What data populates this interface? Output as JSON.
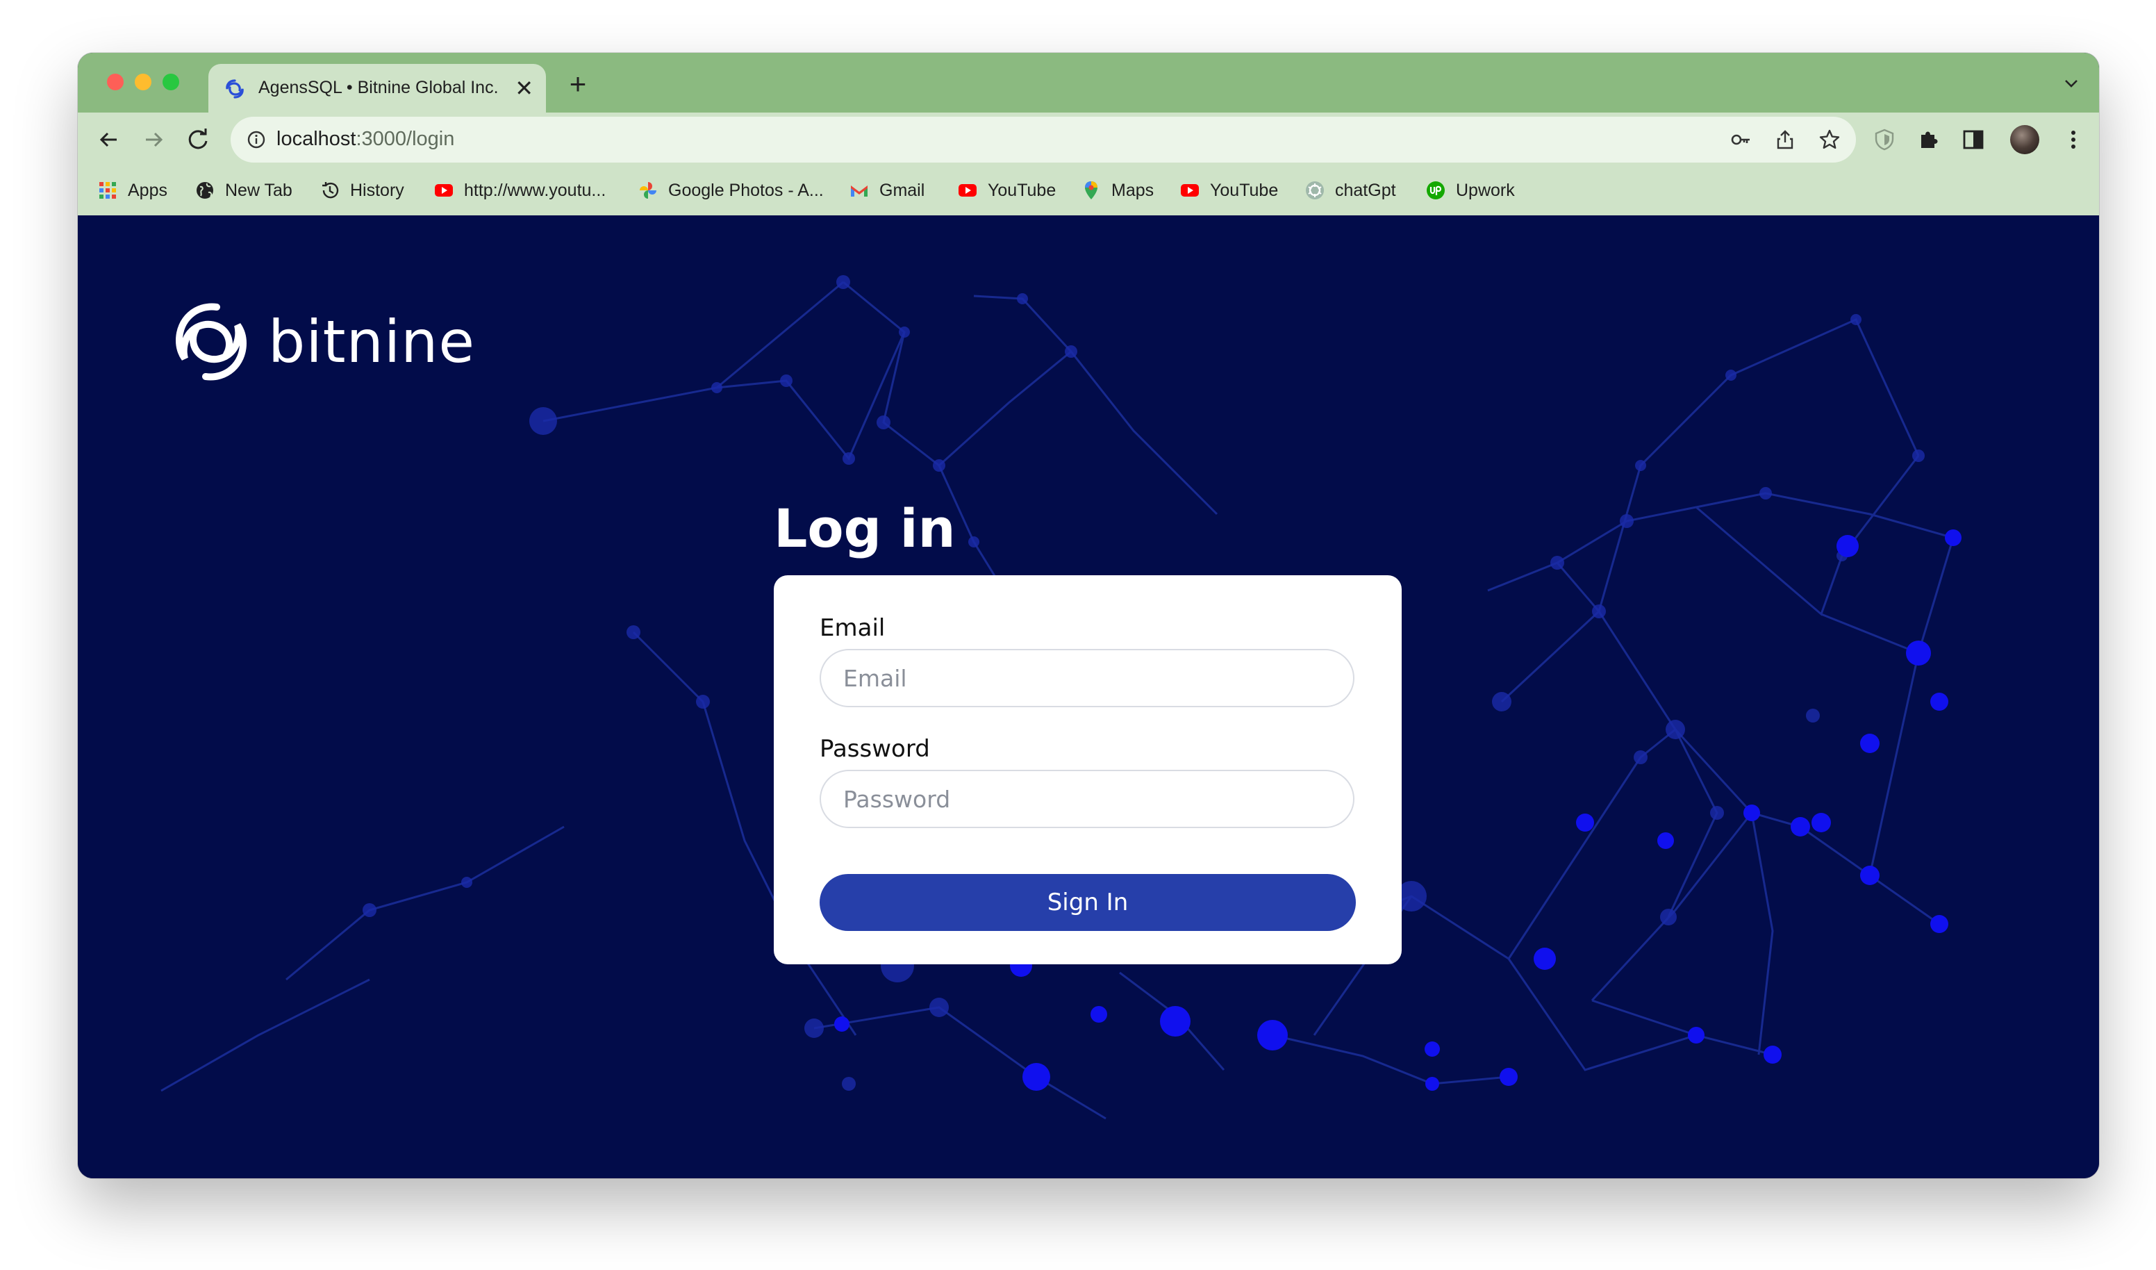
{
  "browser": {
    "tab": {
      "title": "AgensSQL • Bitnine Global Inc.",
      "close": "✕"
    },
    "new_tab": "+",
    "url": {
      "host": "localhost",
      "path": ":3000/login"
    },
    "bookmarks": [
      {
        "label": "Apps",
        "icon": "apps-grid-icon"
      },
      {
        "label": "New Tab",
        "icon": "globe-icon"
      },
      {
        "label": "History",
        "icon": "history-icon"
      },
      {
        "label": "http://www.youtu...",
        "icon": "youtube-icon"
      },
      {
        "label": "Google Photos - A...",
        "icon": "google-photos-icon"
      },
      {
        "label": "Gmail",
        "icon": "gmail-icon"
      },
      {
        "label": "YouTube",
        "icon": "youtube-icon"
      },
      {
        "label": "Maps",
        "icon": "maps-pin-icon"
      },
      {
        "label": "YouTube",
        "icon": "youtube-icon"
      },
      {
        "label": "chatGpt",
        "icon": "chatgpt-icon"
      },
      {
        "label": "Upwork",
        "icon": "upwork-icon"
      }
    ]
  },
  "page": {
    "logo_text": "bitnine",
    "heading": "Log in",
    "form": {
      "email_label": "Email",
      "email_placeholder": "Email",
      "email_value": "",
      "password_label": "Password",
      "password_placeholder": "Password",
      "password_value": "",
      "submit_label": "Sign In"
    }
  },
  "colors": {
    "tab_strip": "#8bba80",
    "toolbar": "#cfe3c8",
    "page_background": "#020c4a",
    "network_accent": "#1a1aff",
    "button": "#263faa",
    "card": "#ffffff"
  }
}
